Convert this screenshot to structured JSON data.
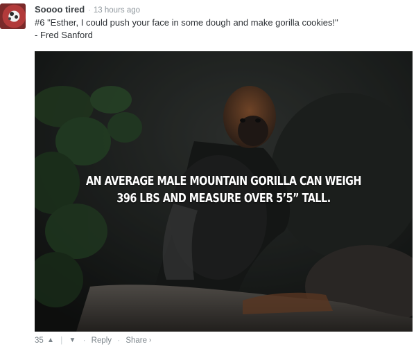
{
  "comment": {
    "author": "Soooo tired",
    "separator": "·",
    "time": "13 hours ago",
    "body_line1": "#6 \"Esther, I could push your face in some dough and make gorilla cookies!\"",
    "body_line2": "- Fred Sanford",
    "image": {
      "overlay_line1": "AN AVERAGE MALE MOUNTAIN GORILLA CAN WEIGH",
      "overlay_line2": "396 LBS  AND MEASURE OVER 5’5” TALL."
    },
    "footer": {
      "votes": "35",
      "upvote_icon": "▲",
      "divider": "|",
      "downvote_icon": "▼",
      "dot": "·",
      "reply_label": "Reply",
      "share_label": "Share",
      "share_icon": "›"
    }
  }
}
